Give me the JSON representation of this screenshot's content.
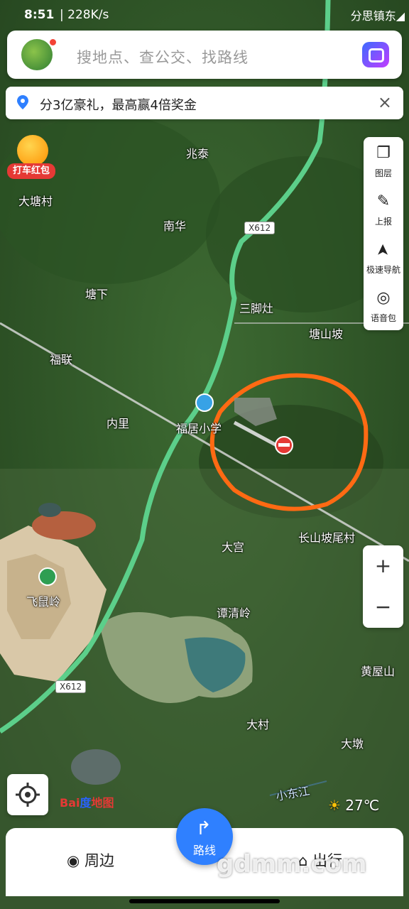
{
  "status_bar": {
    "time": "8:51",
    "speed": "| 228K/s",
    "right_text": "分思镇东◢"
  },
  "search": {
    "placeholder": "搜地点、查公交、找路线"
  },
  "notice": {
    "text": "分3亿豪礼，最高赢4倍奖金",
    "close": "×"
  },
  "hongbao": {
    "label": "打车红包"
  },
  "side_tools": [
    {
      "label": "图层",
      "icon": "layers-icon",
      "glyph": "❐"
    },
    {
      "label": "上报",
      "icon": "report-icon",
      "glyph": "✎"
    },
    {
      "label": "极速导航",
      "icon": "navigation-icon",
      "glyph": "➤"
    },
    {
      "label": "语音包",
      "icon": "voice-pack-icon",
      "glyph": "◎"
    }
  ],
  "map_labels": {
    "dataicun": "大塘村",
    "zhaotai": "兆泰",
    "nanhua": "南华",
    "tangxia": "塘下",
    "sanjiaozao": "三脚灶",
    "tangshanpo": "塘山坡",
    "fulian": "福联",
    "neili": "内里",
    "fujuxiaoxue": "福居小学",
    "changshanpo": "长山坡尾村",
    "dagong": "大宫",
    "feishuling": "飞鼠岭",
    "tanqingling": "谭清岭",
    "huangwushan": "黄屋山",
    "dacun": "大村",
    "dajing": "大墩",
    "xiaodongjiang": "小东江",
    "road1": "X612",
    "road2": "X612"
  },
  "zoom": {
    "plus": "+",
    "minus": "−"
  },
  "brand": {
    "bai": "Bai",
    "du": "度",
    "map": "地图"
  },
  "weather": {
    "temp": "27℃"
  },
  "bottom": {
    "nearby": "周边",
    "route": "路线",
    "travel": "出行"
  },
  "watermark": "gdmm.com",
  "colors": {
    "accent": "#2f80ff",
    "road": "#5ccf8a",
    "circle": "#ff6a13",
    "forest": "#2f5a26"
  }
}
